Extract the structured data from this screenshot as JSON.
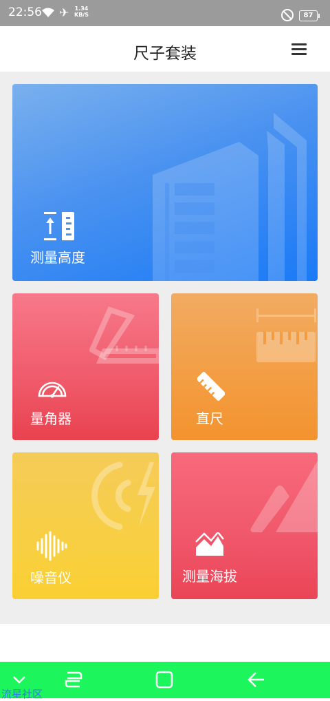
{
  "status_bar": {
    "time": "22:56",
    "net_speed_value": "1.34",
    "net_speed_unit": "KB/S",
    "battery": "87"
  },
  "header": {
    "title": "尺子套装"
  },
  "tiles": {
    "height": {
      "label": "测量高度",
      "color": "#4a92f0"
    },
    "angle": {
      "label": "量角器",
      "color": "#ef5a6a"
    },
    "ruler": {
      "label": "直尺",
      "color": "#f39d42"
    },
    "noise": {
      "label": "噪音仪",
      "color": "#f8cf43"
    },
    "altitude": {
      "label": "测量海拔",
      "color": "#f0566a"
    }
  },
  "nav_bar": {
    "color": "#1cf55c"
  },
  "watermark": {
    "text": "流星社区"
  }
}
